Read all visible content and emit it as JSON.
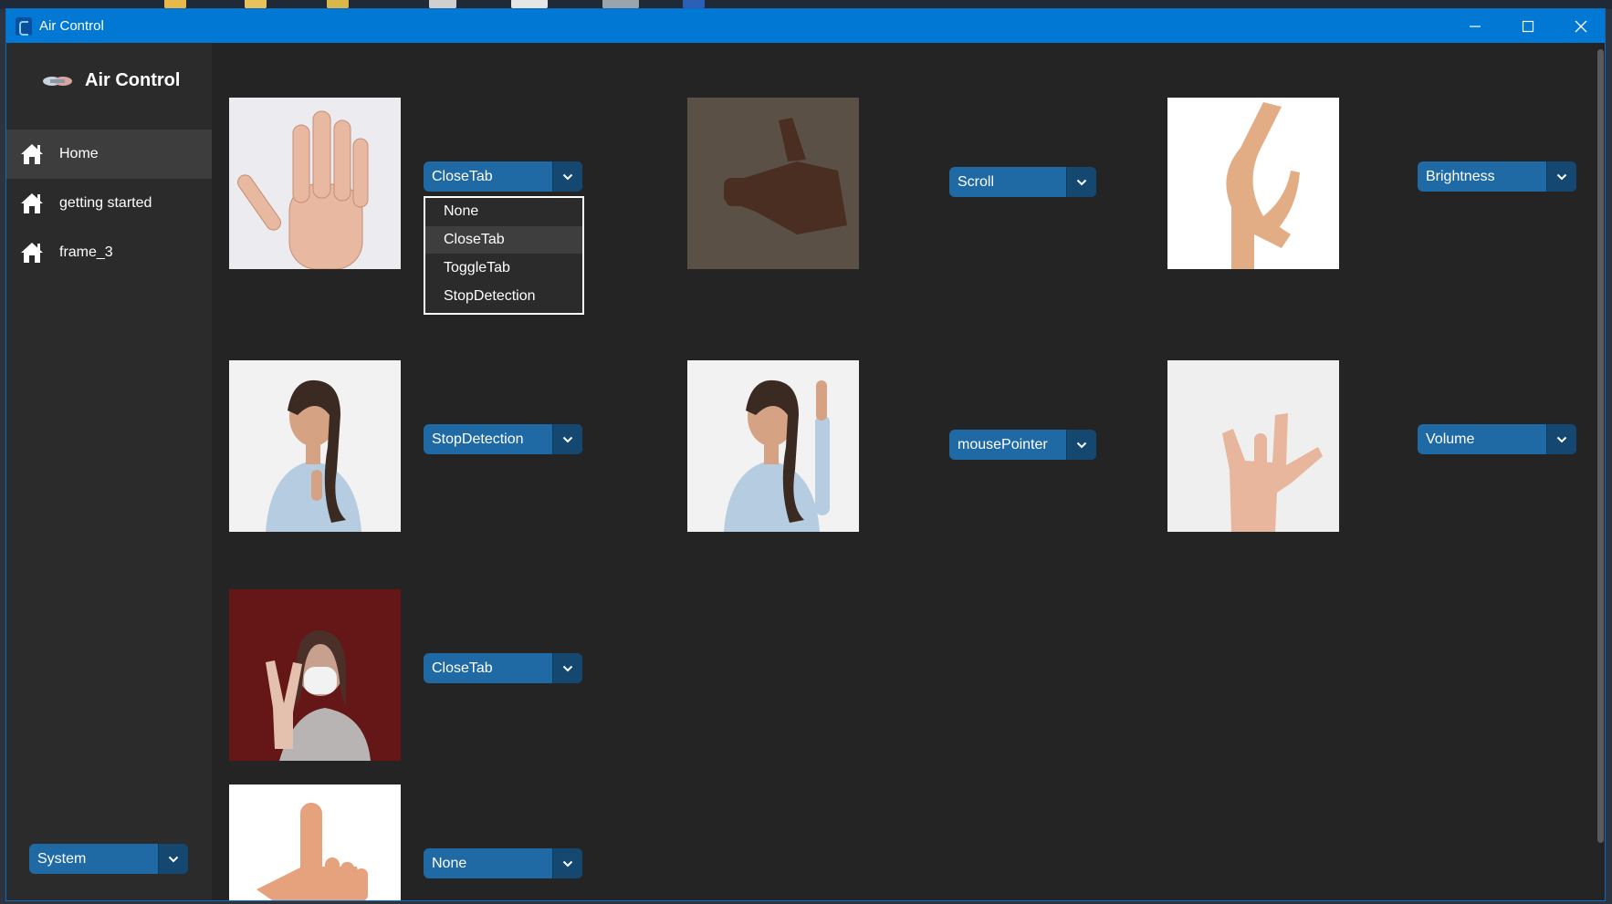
{
  "window": {
    "title": "Air Control",
    "minimize_icon": "minimize-icon",
    "maximize_icon": "maximize-icon",
    "close_icon": "close-icon",
    "titlebar_color": "#0078d4"
  },
  "sidebar": {
    "app_name": "Air Control",
    "items": [
      {
        "label": "Home",
        "icon": "home-icon",
        "active": true
      },
      {
        "label": "getting started",
        "icon": "home-icon",
        "active": false
      },
      {
        "label": "frame_3",
        "icon": "home-icon",
        "active": false
      }
    ],
    "appearance_mode": "System"
  },
  "gestures": [
    {
      "name": "open-palm",
      "action": "CloseTab"
    },
    {
      "name": "finger-gun",
      "action": "Scroll"
    },
    {
      "name": "c-shape",
      "action": "Brightness"
    },
    {
      "name": "index-finger-at-chest",
      "action": "StopDetection"
    },
    {
      "name": "index-finger-up",
      "action": "mousePointer"
    },
    {
      "name": "rock-sign",
      "action": "Volume"
    },
    {
      "name": "peace-sign",
      "action": "CloseTab"
    },
    {
      "name": "l-shape",
      "action": "None"
    }
  ],
  "open_dropdown": {
    "options": [
      "None",
      "CloseTab",
      "ToggleTab",
      "StopDetection"
    ],
    "selected": "CloseTab"
  },
  "colors": {
    "accent": "#1f6aa5",
    "accent_dark": "#144870",
    "background": "#242424",
    "sidebar": "#2b2b2b"
  }
}
